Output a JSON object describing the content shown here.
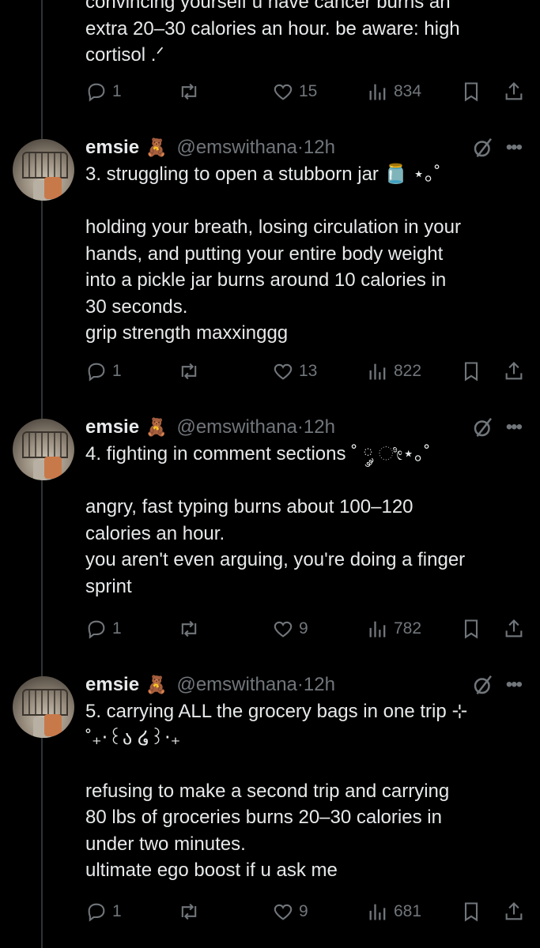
{
  "top_tweet": {
    "text_lines": [
      "convincing yourself u have cancer burns an",
      "extra 20–30 calories an hour. be aware: high",
      "cortisol .ᐟ"
    ],
    "replies": "1",
    "likes": "15",
    "views": "834"
  },
  "tweets": [
    {
      "name": "emsie",
      "emoji": "🧸",
      "handle": "@emswithana",
      "dot": "·",
      "time": "12h",
      "text": "3. struggling to open a stubborn jar 🫙 ⋆｡˚\n\nholding your breath, losing circulation in your\nhands, and putting your entire body weight\ninto a pickle jar burns around 10 calories in\n30 seconds.\ngrip strength maxxinggg",
      "replies": "1",
      "likes": "13",
      "views": "822"
    },
    {
      "name": "emsie",
      "emoji": "🧸",
      "handle": "@emswithana",
      "dot": "·",
      "time": "12h",
      "text": "4. fighting in comment sections ˚ ༘ ೀ⋆｡˚\n\nangry, fast typing burns about 100–120\ncalories an hour.\nyou aren't even arguing, you're doing a finger\nsprint",
      "replies": "1",
      "likes": "9",
      "views": "782"
    },
    {
      "name": "emsie",
      "emoji": "🧸",
      "handle": "@emswithana",
      "dot": "·",
      "time": "12h",
      "text": "5. carrying ALL the grocery bags in one trip ⊹\n˚₊‧꒰ა ໒꒱‧₊\n\nrefusing to make a second trip and carrying\n80 lbs of groceries burns 20–30 calories in\nunder two minutes.\nultimate ego boost if u ask me",
      "replies": "1",
      "likes": "9",
      "views": "681"
    }
  ],
  "colors": {
    "background": "#000000",
    "text": "#e7e9ea",
    "muted": "#71767b",
    "divider": "#2f3336"
  },
  "icons": [
    "reply-icon",
    "retweet-icon",
    "like-icon",
    "views-icon",
    "bookmark-icon",
    "share-icon",
    "grok-icon",
    "more-icon"
  ]
}
